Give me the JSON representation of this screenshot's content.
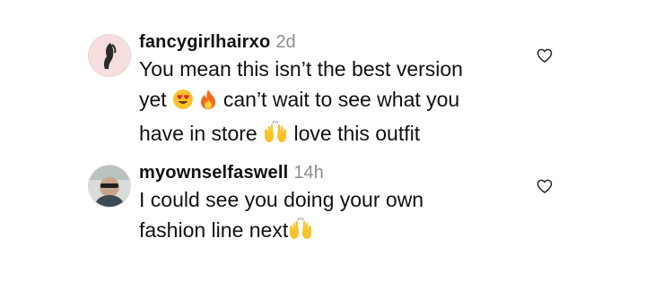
{
  "comments": [
    {
      "username": "fancygirlhairxo",
      "time": "2d",
      "lines": [
        {
          "text": "You mean this isn’t the best version"
        },
        {
          "text": "yet",
          "after_emoji": "can’t wait to see what you"
        },
        {
          "text": "have in store",
          "after_emoji": "love this outfit"
        }
      ],
      "emoji": [
        "heart-eyes-emoji",
        "fire-emoji",
        "raising-hands-emoji"
      ]
    },
    {
      "username": "myownselfaswell",
      "time": "14h",
      "lines": [
        {
          "text": "I could see you doing your own"
        },
        {
          "text": "fashion line next"
        }
      ],
      "emoji": [
        "raising-hands-emoji"
      ]
    }
  ],
  "icons": {
    "like": "heart-outline-icon"
  },
  "colors": {
    "text": "#111111",
    "timestamp": "#8e8e8e",
    "emoji_yellow": "#f7c22a",
    "fire": "#f26a1b"
  }
}
